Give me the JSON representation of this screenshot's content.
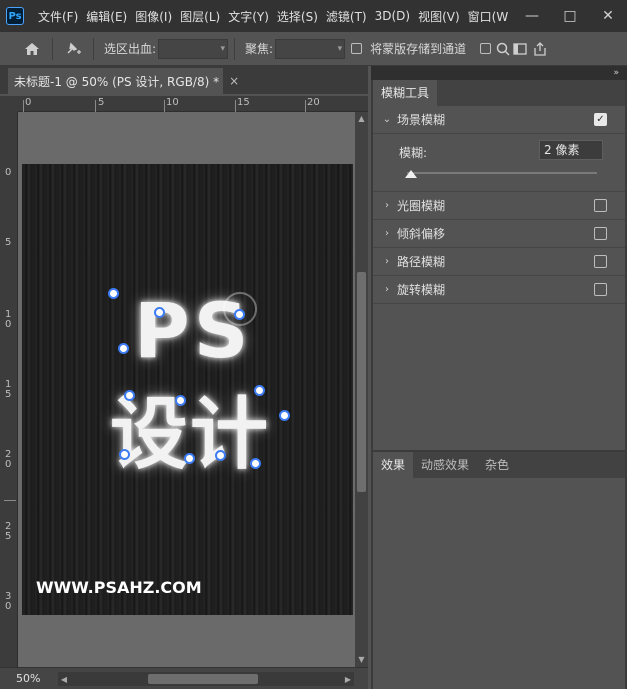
{
  "app": {
    "logo": "Ps",
    "menu": [
      "文件(F)",
      "编辑(E)",
      "图像(I)",
      "图层(L)",
      "文字(Y)",
      "选择(S)",
      "滤镜(T)",
      "3D(D)",
      "视图(V)",
      "窗口(W"
    ],
    "window_controls": [
      "—",
      "□",
      "✕"
    ]
  },
  "options": {
    "selection_bleed_label": "选区出血:",
    "focus_label": "聚焦:",
    "save_mask_label": "将蒙版存储到通道"
  },
  "document": {
    "tab_title": "未标题-1 @ 50% (PS 设计, RGB/8) *",
    "tab_close": "×",
    "canvas_text_line1": "PS",
    "canvas_text_line2": "设计",
    "watermark": "WWW.PSAHZ.COM"
  },
  "rulers": {
    "top": [
      "0",
      "5",
      "10",
      "15",
      "20"
    ],
    "left": [
      "0",
      "5",
      "10",
      "15",
      "20",
      "25",
      "30"
    ]
  },
  "status": {
    "zoom": "50%"
  },
  "blur_panel": {
    "tab": "模糊工具",
    "field_blur": {
      "label": "场景模糊",
      "checked": true
    },
    "blur_amount_label": "模糊:",
    "blur_amount_value": "2 像素",
    "iris_blur": {
      "label": "光圈模糊",
      "checked": false
    },
    "tilt_shift": {
      "label": "倾斜偏移",
      "checked": false
    },
    "path_blur": {
      "label": "路径模糊",
      "checked": false
    },
    "spin_blur": {
      "label": "旋转模糊",
      "checked": false
    }
  },
  "effects_panel": {
    "tabs": [
      "效果",
      "动感效果",
      "杂色"
    ]
  },
  "colors": {
    "accent": "#31a8ff",
    "pin_border": "#3d7cf5"
  }
}
